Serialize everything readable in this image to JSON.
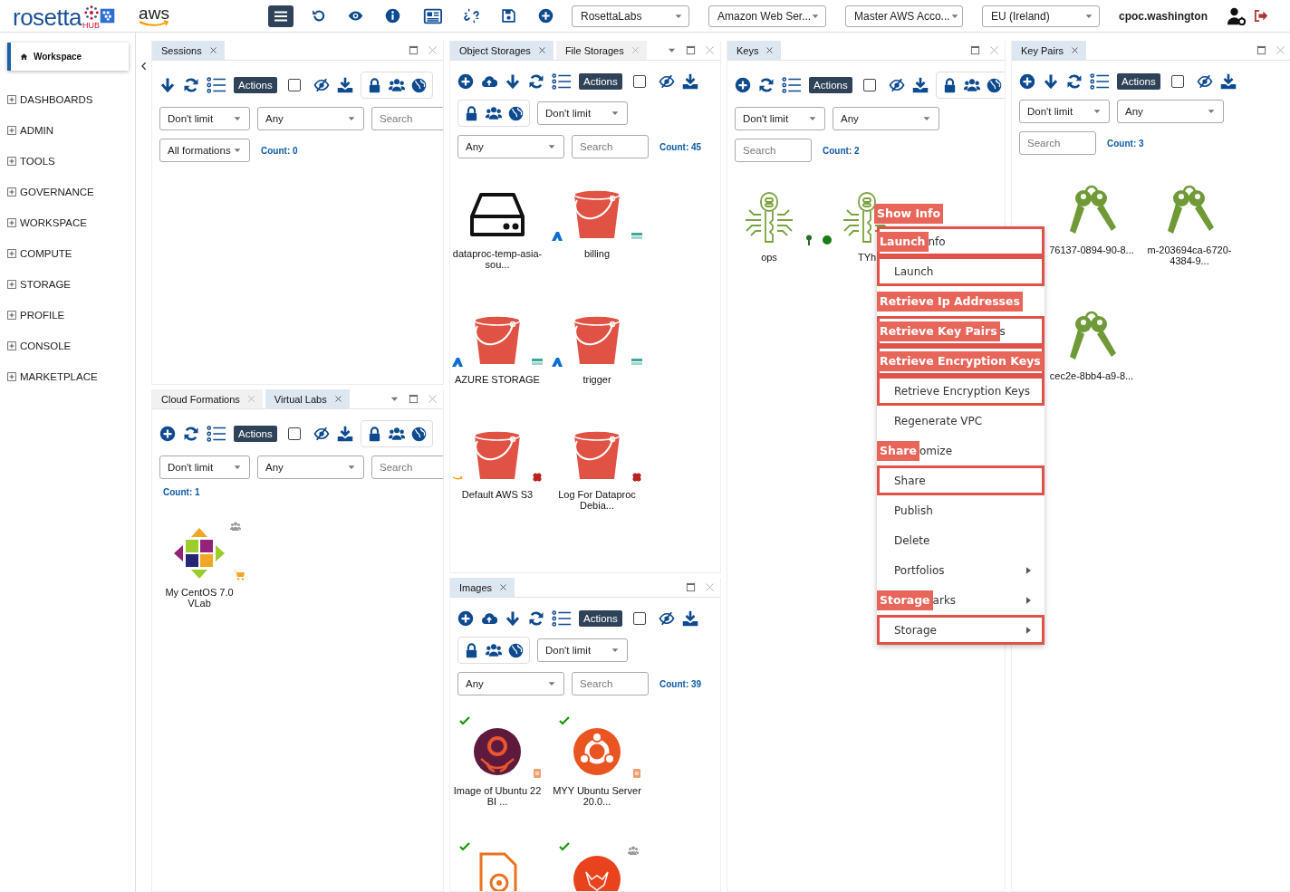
{
  "topbar": {
    "logo": "rosetta",
    "logo_sub": "HUB",
    "aws_logo": "aws",
    "selects": [
      "RosettaLabs",
      "Amazon Web Ser...",
      "Master AWS Acco...",
      "EU (Ireland)"
    ],
    "user": "cpoc.washington"
  },
  "sidebar": {
    "tab": "Workspace",
    "items": [
      {
        "label": "DASHBOARDS",
        "expanded": false
      },
      {
        "label": "ADMIN",
        "expanded": false
      },
      {
        "label": "TOOLS",
        "expanded": false
      },
      {
        "label": "GOVERNANCE",
        "expanded": false
      },
      {
        "label": "WORKSPACE",
        "expanded": false
      },
      {
        "label": "COMPUTE",
        "expanded": false
      },
      {
        "label": "STORAGE",
        "expanded": false
      },
      {
        "label": "PROFILE",
        "expanded": false
      },
      {
        "label": "CONSOLE",
        "expanded": false
      },
      {
        "label": "MARKETPLACE",
        "expanded": false
      }
    ]
  },
  "columns": [
    [
      {
        "tabs": [
          {
            "label": "Sessions",
            "selected": true
          }
        ],
        "tab_menu": false,
        "rows": [
          [
            {
              "kind": "import"
            },
            {
              "kind": "refresh"
            },
            {
              "kind": "list"
            },
            {
              "kind": "actions",
              "label": "Actions"
            },
            {
              "kind": "checkbox",
              "checked": false
            },
            {
              "kind": "visibility"
            },
            {
              "kind": "download"
            },
            {
              "kind": "access"
            }
          ],
          [
            {
              "kind": "select",
              "value": "Don't limit"
            },
            {
              "kind": "select",
              "value": "Any"
            },
            {
              "kind": "search",
              "placeholder": "Search"
            }
          ],
          [
            {
              "kind": "select",
              "value": "All formations"
            },
            {
              "kind": "count",
              "text": "Count: 0"
            }
          ]
        ]
      },
      {
        "tabs": [
          {
            "label": "Cloud Formations",
            "selected": false
          },
          {
            "label": "Virtual Labs",
            "selected": true
          }
        ],
        "tab_menu": true,
        "rows": [
          [
            {
              "kind": "add"
            },
            {
              "kind": "refresh"
            },
            {
              "kind": "list"
            },
            {
              "kind": "actions",
              "label": "Actions"
            },
            {
              "kind": "checkbox",
              "checked": false
            },
            {
              "kind": "visibility"
            },
            {
              "kind": "download"
            },
            {
              "kind": "access"
            }
          ],
          [
            {
              "kind": "select",
              "value": "Don't limit"
            },
            {
              "kind": "select",
              "value": "Any"
            },
            {
              "kind": "search",
              "placeholder": "Search"
            }
          ],
          [
            {
              "kind": "count",
              "text": "Count: 1"
            }
          ]
        ],
        "items": [
          {
            "label": "My CentOS 7.0 VLab",
            "kind": "pinwheel",
            "badges": [
              {
                "kind": "group"
              },
              {
                "kind": "cart"
              }
            ]
          }
        ]
      }
    ],
    [
      {
        "tabs": [
          {
            "label": "Object Storages",
            "selected": true
          },
          {
            "label": "File Storages",
            "selected": false
          }
        ],
        "tab_menu": true,
        "rows": [
          [
            {
              "kind": "add"
            },
            {
              "kind": "upload"
            },
            {
              "kind": "import"
            },
            {
              "kind": "refresh"
            },
            {
              "kind": "list"
            },
            {
              "kind": "actions",
              "label": "Actions"
            },
            {
              "kind": "checkbox",
              "checked": false
            },
            {
              "kind": "visibility"
            },
            {
              "kind": "download"
            }
          ],
          [
            {
              "kind": "access"
            },
            {
              "kind": "select",
              "value": "Don't limit"
            }
          ],
          [
            {
              "kind": "select",
              "value": "Any"
            },
            {
              "kind": "search",
              "placeholder": "Search"
            },
            {
              "kind": "count",
              "text": "Count: 45"
            }
          ]
        ],
        "items": [
          {
            "label": "dataproc-temp-asia-sou...",
            "kind": "drive"
          },
          {
            "label": "billing",
            "kind": "bucket",
            "badges": [
              {
                "kind": "azure"
              },
              {
                "kind": "storage"
              }
            ]
          },
          {
            "label": "AZURE STORAGE",
            "kind": "bucket",
            "badges": [
              {
                "kind": "azure"
              },
              {
                "kind": "storage"
              }
            ]
          },
          {
            "label": "trigger",
            "kind": "bucket",
            "badges": [
              {
                "kind": "azure"
              },
              {
                "kind": "storage"
              }
            ]
          },
          {
            "label": "Default AWS S3",
            "kind": "bucket",
            "badges": [
              {
                "kind": "aws"
              },
              {
                "kind": "chip"
              }
            ]
          },
          {
            "label": "Log For Dataproc Debia...",
            "kind": "bucket",
            "badges": [
              {
                "kind": "chip"
              }
            ]
          }
        ]
      },
      {
        "tabs": [
          {
            "label": "Images",
            "selected": true
          }
        ],
        "tab_menu": false,
        "rows": [
          [
            {
              "kind": "add"
            },
            {
              "kind": "upload"
            },
            {
              "kind": "import"
            },
            {
              "kind": "refresh"
            },
            {
              "kind": "list"
            },
            {
              "kind": "actions",
              "label": "Actions"
            },
            {
              "kind": "checkbox",
              "checked": false
            },
            {
              "kind": "visibility"
            },
            {
              "kind": "download"
            }
          ],
          [
            {
              "kind": "access"
            },
            {
              "kind": "select",
              "value": "Don't limit"
            }
          ],
          [
            {
              "kind": "select",
              "value": "Any"
            },
            {
              "kind": "search",
              "placeholder": "Search"
            },
            {
              "kind": "count",
              "text": "Count: 39"
            }
          ]
        ],
        "items": [
          {
            "label": "Image of Ubuntu 22 BI ...",
            "kind": "jellyfish",
            "badges": [
              {
                "kind": "check"
              },
              {
                "kind": "package"
              }
            ]
          },
          {
            "label": "MYY Ubuntu Server 20.0...",
            "kind": "ring",
            "badges": [
              {
                "kind": "check"
              },
              {
                "kind": "package"
              }
            ]
          },
          {
            "kind": "docgear",
            "badges": [
              {
                "kind": "check"
              }
            ]
          },
          {
            "kind": "fox",
            "badges": [
              {
                "kind": "check"
              },
              {
                "kind": "group"
              }
            ]
          }
        ]
      }
    ],
    [
      {
        "tabs": [
          {
            "label": "Keys",
            "selected": true
          }
        ],
        "tab_menu": false,
        "rows": [
          [
            {
              "kind": "add"
            },
            {
              "kind": "refresh"
            },
            {
              "kind": "list"
            },
            {
              "kind": "actions",
              "label": "Actions"
            },
            {
              "kind": "checkbox",
              "checked": false
            },
            {
              "kind": "visibility"
            },
            {
              "kind": "download"
            },
            {
              "kind": "access"
            }
          ],
          [
            {
              "kind": "select",
              "value": "Don't limit"
            },
            {
              "kind": "select",
              "value": "Any"
            }
          ],
          [
            {
              "kind": "search",
              "placeholder": "Search"
            },
            {
              "kind": "count",
              "text": "Count: 2"
            }
          ]
        ],
        "items": [
          {
            "label": "ops",
            "kind": "circuitkey",
            "badges": [
              {
                "kind": "key"
              }
            ]
          },
          {
            "label": "TYh",
            "kind": "circuitkey",
            "badges": [
              {
                "kind": "dot"
              }
            ]
          }
        ]
      }
    ],
    [
      {
        "tabs": [
          {
            "label": "Key Pairs",
            "selected": true
          }
        ],
        "tab_menu": false,
        "rows": [
          [
            {
              "kind": "add"
            },
            {
              "kind": "import"
            },
            {
              "kind": "refresh"
            },
            {
              "kind": "list"
            },
            {
              "kind": "actions",
              "label": "Actions"
            },
            {
              "kind": "checkbox",
              "checked": false
            },
            {
              "kind": "visibility"
            },
            {
              "kind": "download"
            }
          ],
          [
            {
              "kind": "select",
              "value": "Don't limit"
            },
            {
              "kind": "select",
              "value": "Any"
            }
          ],
          [
            {
              "kind": "search",
              "placeholder": "Search"
            },
            {
              "kind": "count",
              "text": "Count: 3"
            }
          ]
        ],
        "items": [
          {
            "label": "76137-0894-90-8...",
            "kind": "keys"
          },
          {
            "label": "m-203694ca-6720-4384-9...",
            "kind": "keys"
          },
          {
            "label": "cec2e-8bb4-a9-8...",
            "kind": "keys"
          }
        ]
      }
    ]
  ],
  "context_menu": {
    "items": [
      {
        "label": "nfo",
        "highlighted": true,
        "tag": "Show Info",
        "submenu": false
      },
      {
        "label": "Launch",
        "highlighted": true,
        "tag": "Launch",
        "submenu": false
      },
      {
        "highlighted": false,
        "submenu": false
      },
      {
        "label": "s",
        "highlighted": true,
        "tag": "Retrieve Ip Addresses",
        "submenu": false
      },
      {
        "highlighted": true,
        "tag": "Retrieve Key Pairs",
        "submenu": false
      },
      {
        "label": "Retrieve Encryption Keys",
        "highlighted": true,
        "tag": "Retrieve Encryption Keys",
        "submenu": false
      },
      {
        "label": "Regenerate VPC",
        "highlighted": false,
        "submenu": false
      },
      {
        "label": "omize",
        "highlighted": false,
        "submenu": false
      },
      {
        "label": "Share",
        "highlighted": true,
        "tag": "Share",
        "submenu": false
      },
      {
        "label": "Publish",
        "highlighted": false,
        "submenu": false
      },
      {
        "label": "Delete",
        "highlighted": false,
        "submenu": false
      },
      {
        "label": "Portfolios",
        "highlighted": false,
        "submenu": true
      },
      {
        "label": "arks",
        "highlighted": false,
        "submenu": true
      },
      {
        "label": "Storage",
        "highlighted": true,
        "tag": "Storage",
        "submenu": true
      }
    ]
  }
}
